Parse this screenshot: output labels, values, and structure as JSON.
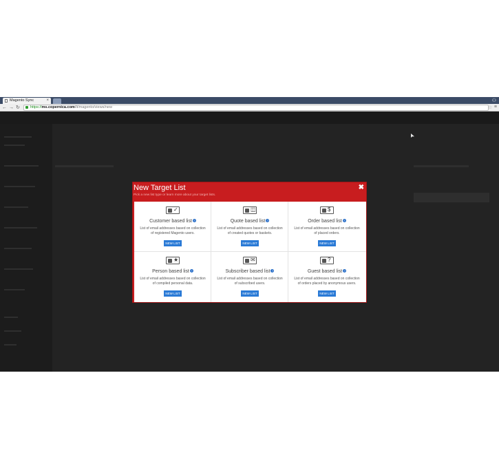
{
  "browser": {
    "tab_title": "Magento Sync",
    "tab_close": "×",
    "url_scheme": "https://",
    "url_host": "ms.copernica.com",
    "url_path": "/lt/magento/views/new",
    "star_icon": "star-icon",
    "menu_icon": "menu-icon"
  },
  "modal": {
    "title": "New Target List",
    "subtitle": "Pick a new list type or learn more about your target lists.",
    "close": "✖",
    "cards": [
      {
        "title": "Customer based list",
        "help": "?",
        "icon": "customer-list-icon",
        "symbol": "✓",
        "desc": "List of email addresses based on collection of registered Magento users.",
        "button": "NEW LIST"
      },
      {
        "title": "Quote based list",
        "help": "?",
        "icon": "quote-list-icon",
        "symbol": "◫",
        "desc": "List of email addresses based on collection of created quotes or baskets.",
        "button": "NEW LIST"
      },
      {
        "title": "Order based list",
        "help": "?",
        "icon": "order-list-icon",
        "symbol": "$",
        "desc": "List of email addresses based on collection of placed orders.",
        "button": "NEW LIST"
      },
      {
        "title": "Person based list",
        "help": "?",
        "icon": "person-list-icon",
        "symbol": "★",
        "desc": "List of email addresses based on collection of compiled personal data.",
        "button": "NEW LIST"
      },
      {
        "title": "Subscriber based list",
        "help": "?",
        "icon": "subscriber-list-icon",
        "symbol": "✉",
        "desc": "List of email addresses based on collection of subscribed users.",
        "button": "NEW LIST"
      },
      {
        "title": "Guest based list",
        "help": "?",
        "icon": "guest-list-icon",
        "symbol": "?",
        "desc": "List of email addresses based on collection of orders placed by anonymous users.",
        "button": "NEW LIST"
      }
    ]
  },
  "colors": {
    "modal_red": "#c81d1f",
    "button_blue": "#2a7ad6",
    "backdrop": "#232323"
  }
}
